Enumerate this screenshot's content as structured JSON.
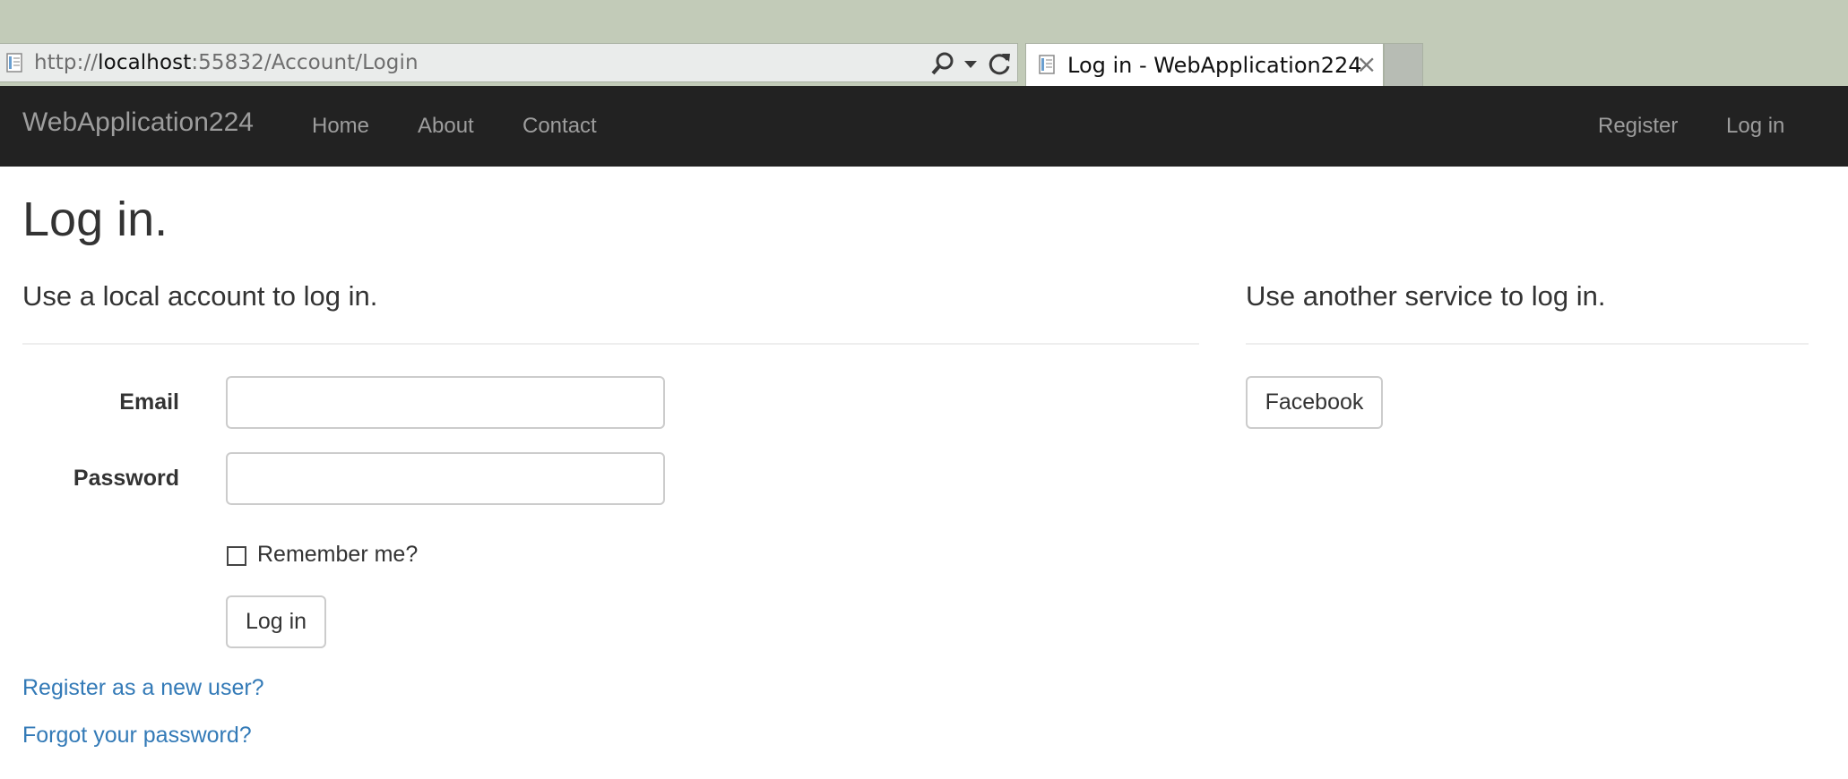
{
  "browser": {
    "url_prefix": "http://",
    "url_host": "localhost",
    "url_rest": ":55832/Account/Login",
    "tab_title": "Log in - WebApplication224",
    "tab_close": "×"
  },
  "navbar": {
    "brand": "WebApplication224",
    "left_links": [
      "Home",
      "About",
      "Contact"
    ],
    "right_links": [
      "Register",
      "Log in"
    ]
  },
  "page": {
    "title": "Log in.",
    "local_heading": "Use a local account to log in.",
    "external_heading": "Use another service to log in.",
    "email_label": "Email",
    "email_value": "",
    "password_label": "Password",
    "password_value": "",
    "remember_label": "Remember me?",
    "remember_checked": false,
    "login_button": "Log in",
    "facebook_button": "Facebook",
    "register_link": "Register as a new user?",
    "forgot_link": "Forgot your password?"
  },
  "colors": {
    "navbar_bg": "#222222",
    "navbar_text": "#9d9d9d",
    "link": "#337ab7",
    "chrome_bg": "#c2cbb8"
  }
}
